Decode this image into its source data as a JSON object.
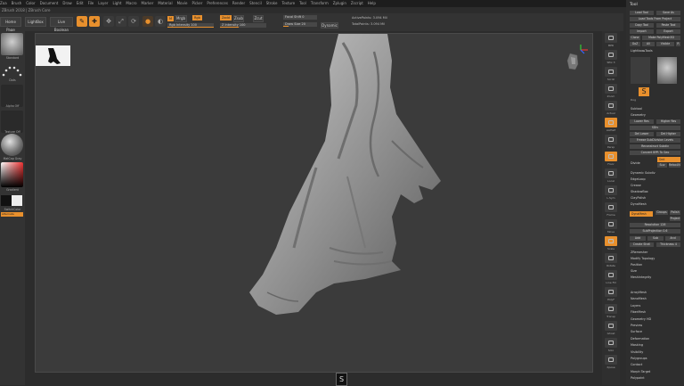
{
  "menubar": {
    "items": [
      "Zoa",
      "Brush",
      "Color",
      "Document",
      "Draw",
      "Edit",
      "File",
      "Layer",
      "Light",
      "Macro",
      "Marker",
      "Material",
      "Movie",
      "Picker",
      "Preferences",
      "Render",
      "Stencil",
      "Stroke",
      "Texture",
      "Tool",
      "Transform",
      "Zplugin",
      "Zscript",
      "Help"
    ]
  },
  "status": {
    "text": "ZBrush 2018 | ZBrush Core"
  },
  "topbar": {
    "home_page": "Home Page",
    "lightbox": "LightBox",
    "live_boolean": "Live Boolean",
    "edit": "Edit",
    "draw": "Draw",
    "move": "Move",
    "scale": "Scale",
    "rotate": "Rotate",
    "mrgb": "Mrgb",
    "rgb": "Rgb",
    "m": "M",
    "zadd": "Zadd",
    "zsub": "Zsub",
    "zcut": "Zcut",
    "rgb_intensity": "Rgb Intensity 100",
    "z_intensity": "Z Intensity 100",
    "focal_shift": "Focal Shift 0",
    "draw_size": "Draw Size 20",
    "dynamic": "Dynamic",
    "active_points": "ActivePoints: 3.094 Mil",
    "total_points": "TotalPoints: 3.094 Mil"
  },
  "leftpanel": {
    "brush_label": "Standard",
    "stroke_label": "Dots",
    "alpha_label": "Alpha Off",
    "texture_label": "Texture Off",
    "material_label": "MatCap Gray",
    "gradient_label": "Gradient",
    "switch_color": "SwitchColor",
    "alternate": "Alternate"
  },
  "rightstrip": {
    "labels": [
      "BPR",
      "SPix 3",
      "Scroll",
      "Zoom",
      "Actual",
      "AAHalf",
      "Persp",
      "Floor",
      "Local",
      "L.Sym",
      "Frame",
      "Move",
      "Scale",
      "Rotate",
      "Line Fill",
      "PolyF",
      "Transp",
      "Ghost",
      "Solo",
      "Xpose"
    ]
  },
  "toolpanel": {
    "title": "Tool",
    "load_tool": "Load Tool",
    "save_as": "Save As",
    "load_tools_project": "Load Tools From Project",
    "copy_tool": "Copy Tool",
    "paste_tool": "Paste Tool",
    "import": "Import",
    "export": "Export",
    "clone": "Clone",
    "make_polymesh": "Make PolyMesh3D",
    "goz": "GoZ",
    "all": "All",
    "visible": "Visible",
    "r": "R",
    "lightbox_tools": "Lightbox▸Tools",
    "tool_name": "Dog",
    "subtool": "Subtool",
    "geometry": "Geometry",
    "lower_res": "Lower Res",
    "higher_res": "Higher Res",
    "sdiv": "SDiv",
    "del_lower": "Del Lower",
    "del_higher": "Del Higher",
    "freeze_subdiv": "Freeze SubDivision Levels",
    "reconstruct_subdiv": "Reconstruct Subdiv",
    "convert_bpr": "Convert BPR To Geo",
    "divide": "Divide",
    "smt": "Smt",
    "suv": "Suv",
    "relax": "RelaxUV",
    "dynamic_subdiv": "Dynamic Subdiv",
    "edgeloop": "EdgeLoop",
    "crease": "Crease",
    "shadowbox": "ShadowBox",
    "claypolish": "ClayPolish",
    "dynamesh_sec": "DynaMesh",
    "dynamesh_btn": "DynaMesh",
    "groups": "Groups",
    "polish": "Polish",
    "project": "Project",
    "resolution": "Resolution 128",
    "subproject": "SubProjection 0.6",
    "add": "Add",
    "sub": "Sub",
    "and": "And",
    "create_shell": "Create Shell",
    "thickness": "Thickness 4",
    "zremesher": "ZRemesher",
    "modify_topology": "Modify Topology",
    "position": "Position",
    "size": "Size",
    "meshintegrity": "MeshIntegrity",
    "list": [
      "ArrayMesh",
      "NanoMesh",
      "Layers",
      "FiberMesh",
      "Geometry HD",
      "Preview",
      "Surface",
      "Deformation",
      "Masking",
      "Visibility",
      "Polygroups",
      "Contact",
      "Morph Target",
      "Polypaint"
    ]
  },
  "bottom": {
    "s_label": "S"
  },
  "colors": {
    "accent": "#e8902d",
    "panel": "#333333",
    "canvas": "#3b3b3b"
  }
}
